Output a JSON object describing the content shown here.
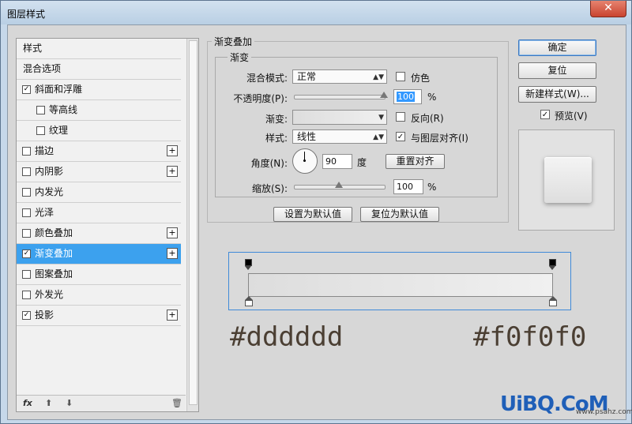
{
  "window": {
    "title": "图层样式",
    "close_glyph": "✕"
  },
  "left_panel": {
    "header": "样式",
    "blend_options": "混合选项",
    "items": [
      {
        "label": "斜面和浮雕",
        "checked": true,
        "plus": false
      },
      {
        "label": "等高线",
        "checked": false,
        "plus": false
      },
      {
        "label": "纹理",
        "checked": false,
        "plus": false
      },
      {
        "label": "描边",
        "checked": false,
        "plus": true
      },
      {
        "label": "内阴影",
        "checked": false,
        "plus": true
      },
      {
        "label": "内发光",
        "checked": false,
        "plus": false
      },
      {
        "label": "光泽",
        "checked": false,
        "plus": false
      },
      {
        "label": "颜色叠加",
        "checked": false,
        "plus": true
      },
      {
        "label": "渐变叠加",
        "checked": true,
        "plus": true,
        "selected": true
      },
      {
        "label": "图案叠加",
        "checked": false,
        "plus": false
      },
      {
        "label": "外发光",
        "checked": false,
        "plus": false
      },
      {
        "label": "投影",
        "checked": true,
        "plus": true
      }
    ],
    "toolbar": {
      "fx": "fx",
      "up": "⬆",
      "down": "⬇",
      "trash": "🗑"
    }
  },
  "gradient_overlay": {
    "section_title": "渐变叠加",
    "group_title": "渐变",
    "blend_mode_label": "混合模式:",
    "blend_mode_value": "正常",
    "dither_label": "仿色",
    "opacity_label": "不透明度(P):",
    "opacity_value": "100",
    "percent": "%",
    "gradient_label": "渐变:",
    "reverse_label": "反向(R)",
    "style_label": "样式:",
    "style_value": "线性",
    "align_label": "与图层对齐(I)",
    "angle_label": "角度(N):",
    "angle_value": "90",
    "degree": "度",
    "reset_align": "重置对齐",
    "scale_label": "缩放(S):",
    "scale_value": "100",
    "set_default": "设置为默认值",
    "reset_default": "复位为默认值",
    "opacity_fraction": 1.0,
    "scale_fraction": 0.5
  },
  "buttons": {
    "ok": "确定",
    "reset": "复位",
    "new_style": "新建样式(W)...",
    "preview_label": "预览(V)"
  },
  "gradient_editor": {
    "start_color": "#dddddd",
    "end_color": "#f0f0f0",
    "start_label": "#dddddd",
    "end_label": "#f0f0f0"
  },
  "watermark": {
    "logo": "UiBQ.CoM",
    "url": "www.psahz.com"
  }
}
